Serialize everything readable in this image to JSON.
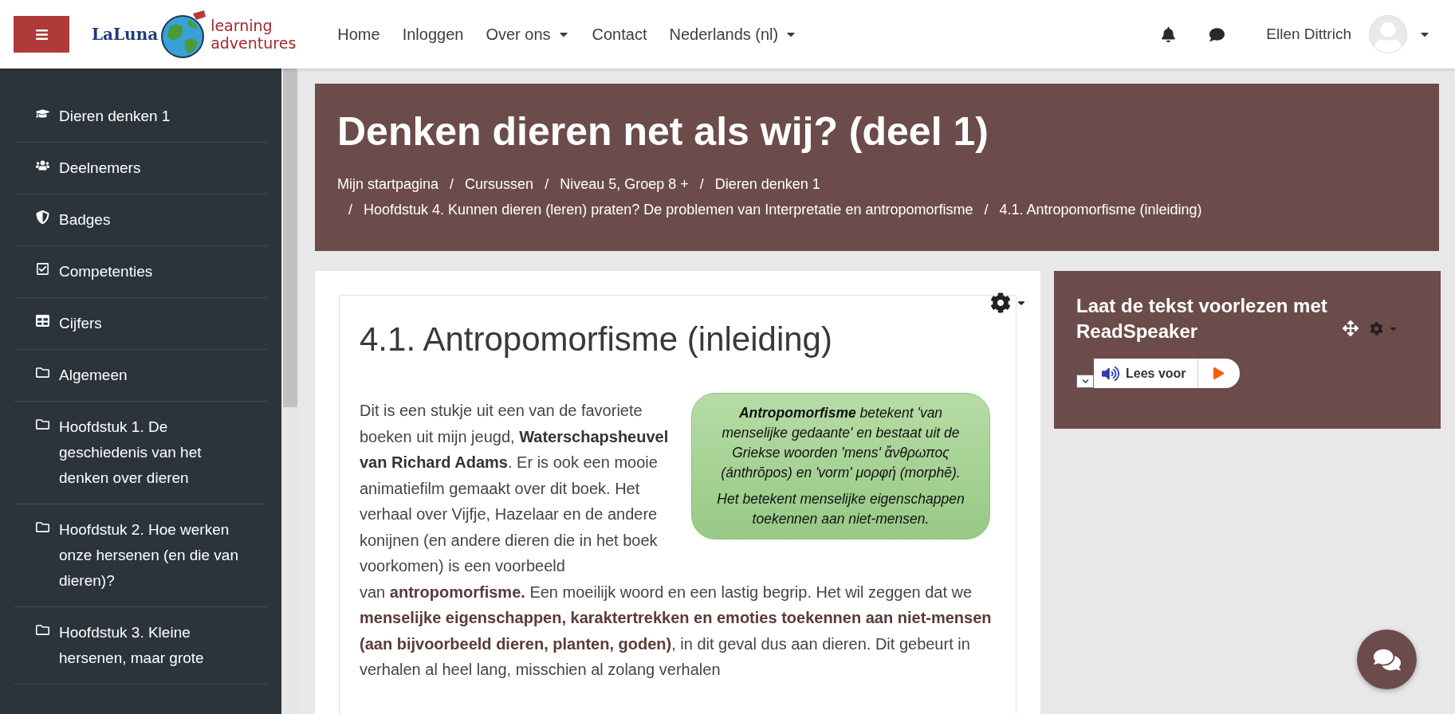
{
  "navbar": {
    "logo": {
      "brand": "LaLuna",
      "tagline_1": "learning",
      "tagline_2": "adventures"
    },
    "menu": [
      {
        "label": "Home",
        "dropdown": false
      },
      {
        "label": "Inloggen",
        "dropdown": false
      },
      {
        "label": "Over ons",
        "dropdown": true
      },
      {
        "label": "Contact",
        "dropdown": false
      },
      {
        "label": "Nederlands (nl)",
        "dropdown": true
      }
    ],
    "user_name": "Ellen Dittrich"
  },
  "sidebar": {
    "items": [
      {
        "kind": "course",
        "label": "Dieren denken 1"
      },
      {
        "kind": "users",
        "label": "Deelnemers"
      },
      {
        "kind": "badge",
        "label": "Badges"
      },
      {
        "kind": "check",
        "label": "Competenties"
      },
      {
        "kind": "grid",
        "label": "Cijfers"
      },
      {
        "kind": "folder",
        "label": "Algemeen"
      },
      {
        "kind": "folder",
        "label": "Hoofdstuk 1. De geschiedenis van het denken over dieren"
      },
      {
        "kind": "folder",
        "label": "Hoofdstuk 2. Hoe werken onze hersenen (en die van dieren)?"
      },
      {
        "kind": "folder",
        "label": "Hoofdstuk 3. Kleine hersenen, maar grote"
      }
    ]
  },
  "header": {
    "title": "Denken dieren net als wij? (deel 1)",
    "separator": "/",
    "breadcrumb": [
      "Mijn startpagina",
      "Cursussen",
      "Niveau 5, Groep 8 +",
      "Dieren denken 1",
      "Hoofdstuk 4. Kunnen dieren (leren) praten? De problemen van Interpretatie en antropomorfisme",
      "4.1. Antropomorfisme (inleiding)"
    ]
  },
  "content": {
    "heading": "4.1. Antropomorfisme (inleiding)",
    "callout": [
      "**Antropomorfisme** betekent 'van menselijke gedaante' en bestaat uit de Griekse woorden 'mens' ἄνθρωπος (ánthrōpos) en 'vorm' μορφή (morphē).",
      "Het betekent menselijke eigenschappen toekennen aan niet-mensen."
    ],
    "body_intro": "Dit is een stukje uit een van de favoriete boeken uit mijn jeugd, **Waterschapsheuvel van Richard Adams**. Er is ook een mooie animatiefilm gemaakt over dit boek. Het verhaal over Vijfje, Hazelaar en de andere konijnen (en andere dieren die in het boek voorkomen) is een voorbeeld",
    "body": "van **antropomorfisme.** Een moeilijk woord en een lastig begrip. Het wil zeggen dat we **menselijke eigenschappen, karaktertrekken en emoties toekennen aan niet-mensen (aan bijvoorbeeld dieren, planten, goden)**, in dit geval dus aan dieren. Dit gebeurt in verhalen al heel lang, misschien al zolang verhalen"
  },
  "block": {
    "title": "Laat de tekst voorlezen met ReadSpeaker",
    "player_label": "Lees voor"
  }
}
